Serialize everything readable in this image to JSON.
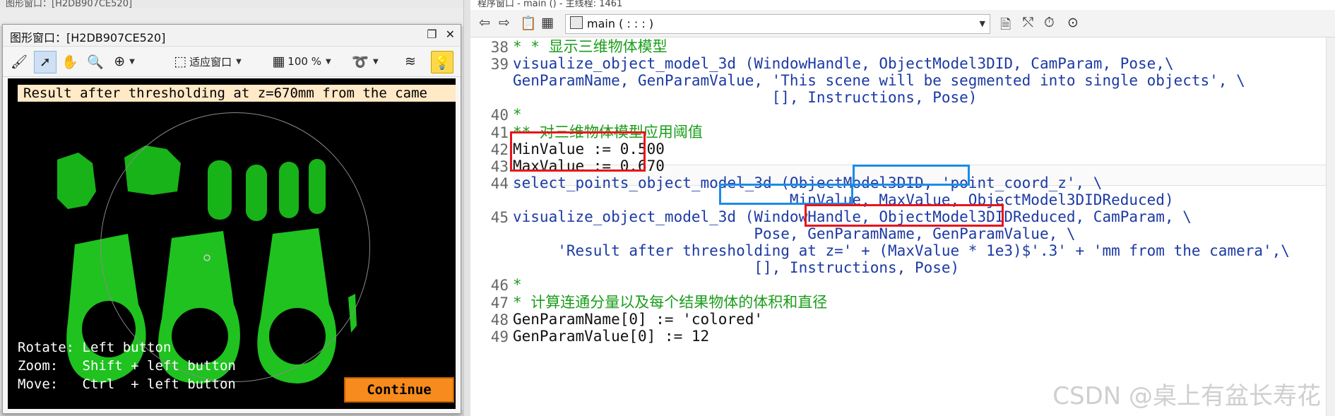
{
  "left_app": {
    "title_partial": "图形窗口：[H2DB907CE520]",
    "graphics_window": {
      "title": "图形窗口：[H2DB907CE520]",
      "toolbar": {
        "fit_label": "适应窗口",
        "zoom_label": "100 %"
      },
      "canvas": {
        "result_text": "Result after thresholding at z=670mm from the came",
        "help": {
          "rotate": "Rotate: Left button",
          "zoom": "Zoom:   Shift + left button",
          "move": "Move:   Ctrl  + left button"
        },
        "continue_label": "Continue"
      }
    }
  },
  "right_app": {
    "title_partial": "程序窗口 - main () - 主线程: 1461",
    "procedure_select": "main ( : : : )",
    "code": [
      {
        "n": "38",
        "text": "* * 显示三维物体模型",
        "kind": "comment"
      },
      {
        "n": "39",
        "text": "visualize_object_model_3d (WindowHandle, ObjectModel3DID, CamParam, Pose,\\",
        "kind": "code"
      },
      {
        "n": "",
        "text": "GenParamName, GenParamValue, 'This scene will be segmented into single objects', \\",
        "kind": "code"
      },
      {
        "n": "",
        "text": "                             [], Instructions, Pose)",
        "kind": "code"
      },
      {
        "n": "40",
        "text": "*",
        "kind": "comment"
      },
      {
        "n": "41",
        "text": "** 对三维物体模型应用阈值",
        "kind": "comment"
      },
      {
        "n": "42",
        "text": "MinValue := 0.500",
        "kind": "assign"
      },
      {
        "n": "43",
        "text": "MaxValue := 0.670",
        "kind": "assign"
      },
      {
        "n": "44",
        "text": "select_points_object_model_3d (ObjectModel3DID, 'point_coord_z', \\",
        "kind": "code"
      },
      {
        "n": "",
        "text": "                               MinValue, MaxValue, ObjectModel3DIDReduced)",
        "kind": "code"
      },
      {
        "n": "45",
        "text": "visualize_object_model_3d (WindowHandle, ObjectModel3DIDReduced, CamParam, \\",
        "kind": "code"
      },
      {
        "n": "",
        "text": "                           Pose, GenParamName, GenParamValue, \\",
        "kind": "code"
      },
      {
        "n": "",
        "text": "     'Result after thresholding at z=' + (MaxValue * 1e3)$'.3' + 'mm from the camera',\\",
        "kind": "code"
      },
      {
        "n": "",
        "text": "                           [], Instructions, Pose)",
        "kind": "code"
      },
      {
        "n": "46",
        "text": "*",
        "kind": "comment"
      },
      {
        "n": "47",
        "text": "* 计算连通分量以及每个结果物体的体积和直径",
        "kind": "comment"
      },
      {
        "n": "48",
        "text": "GenParamName[0] := 'colored'",
        "kind": "assign"
      },
      {
        "n": "49",
        "text": "GenParamValue[0] := 12",
        "kind": "assign"
      }
    ]
  },
  "watermark": "CSDN @桌上有盆长寿花",
  "colors": {
    "code_blue": "#1c3aa3",
    "comment_green": "#1a9d1a",
    "highlight_red": "#e8141a",
    "highlight_blue": "#1a8ce8",
    "continue_orange": "#f78b1e"
  }
}
